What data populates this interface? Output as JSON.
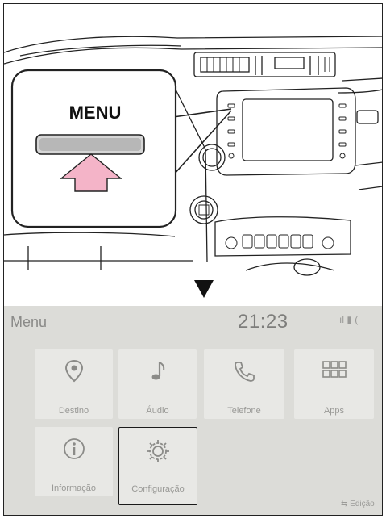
{
  "callout": {
    "label": "MENU"
  },
  "screen": {
    "title": "Menu",
    "clock": "21:23",
    "status_icons": "ıl ▮ (",
    "tiles": [
      {
        "label": "Destino",
        "icon": "map-pin-icon"
      },
      {
        "label": "Áudio",
        "icon": "music-note-icon"
      },
      {
        "label": "Telefone",
        "icon": "phone-icon"
      },
      {
        "label": "Apps",
        "icon": "grid-icon"
      },
      {
        "label": "Informação",
        "icon": "info-icon"
      },
      {
        "label": "Configuração",
        "icon": "gear-icon"
      }
    ],
    "edit_label": "Edição"
  },
  "colors": {
    "accent_arrow": "#f4b4c8",
    "screen_bg": "#dcdcd8",
    "tile_bg": "#e8e8e5"
  }
}
